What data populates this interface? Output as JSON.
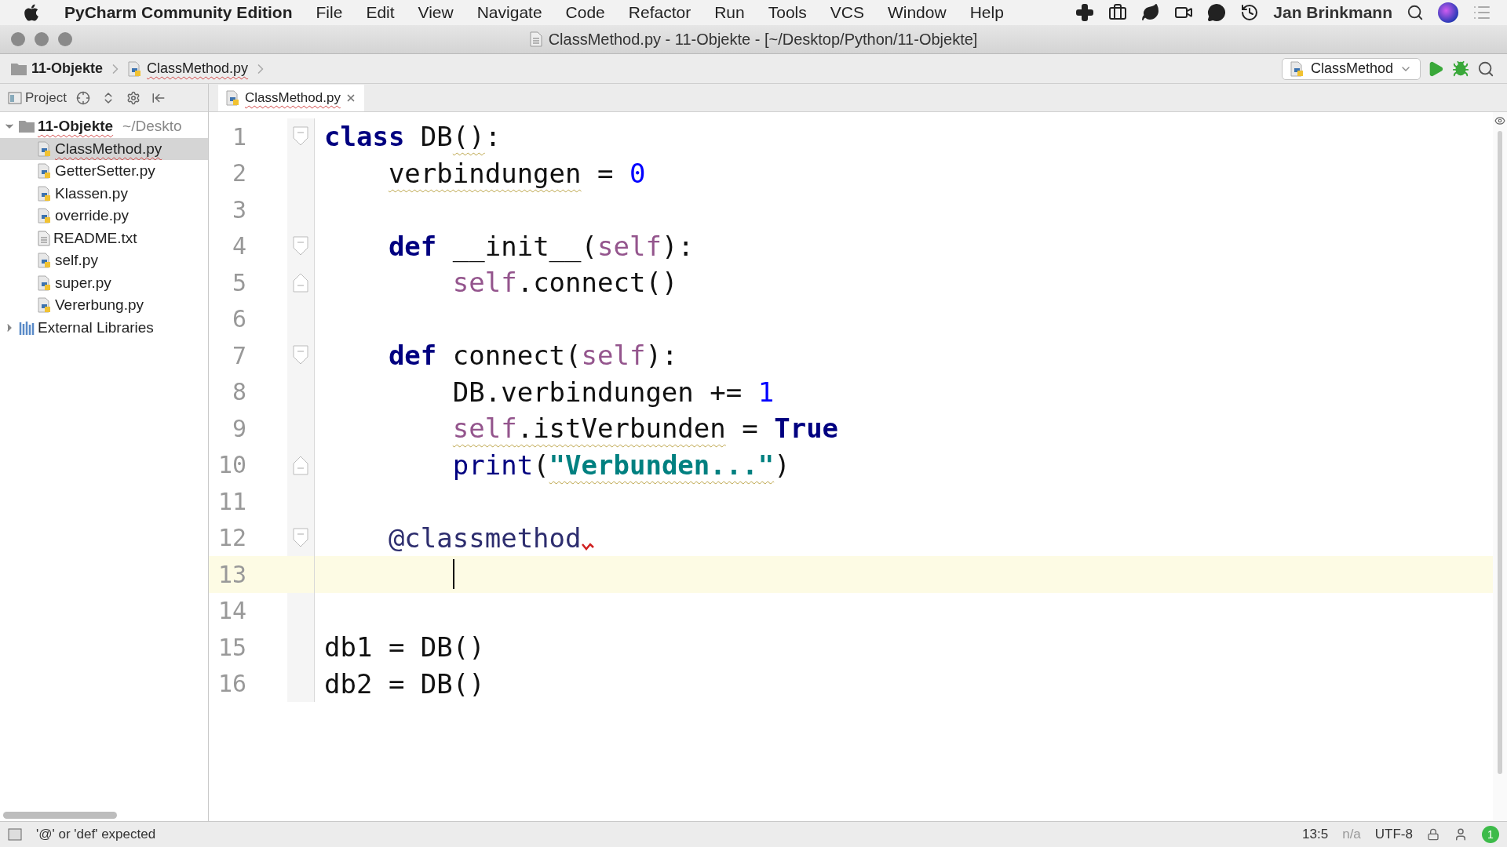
{
  "menu_bar": {
    "app_name": "PyCharm Community Edition",
    "menus": [
      "File",
      "Edit",
      "View",
      "Navigate",
      "Code",
      "Refactor",
      "Run",
      "Tools",
      "VCS",
      "Window",
      "Help"
    ],
    "user": "Jan Brinkmann"
  },
  "window": {
    "title": "ClassMethod.py - 11-Objekte - [~/Desktop/Python/11-Objekte]"
  },
  "breadcrumbs": [
    {
      "label": "11-Objekte",
      "kind": "folder",
      "squiggle": false
    },
    {
      "label": "ClassMethod.py",
      "kind": "python",
      "squiggle": true
    }
  ],
  "run_config": {
    "label": "ClassMethod"
  },
  "project_panel": {
    "label": "Project"
  },
  "tree": [
    {
      "label": "11-Objekte",
      "path": "~/Deskto",
      "kind": "folder",
      "expanded": true,
      "selected": false,
      "squiggle": true,
      "children": [
        {
          "label": "ClassMethod.py",
          "kind": "python",
          "selected": true,
          "squiggle": true
        },
        {
          "label": "GetterSetter.py",
          "kind": "python",
          "selected": false,
          "squiggle": false
        },
        {
          "label": "Klassen.py",
          "kind": "python",
          "selected": false,
          "squiggle": false
        },
        {
          "label": "override.py",
          "kind": "python",
          "selected": false,
          "squiggle": false
        },
        {
          "label": "README.txt",
          "kind": "text",
          "selected": false,
          "squiggle": false
        },
        {
          "label": "self.py",
          "kind": "python",
          "selected": false,
          "squiggle": false
        },
        {
          "label": "super.py",
          "kind": "python",
          "selected": false,
          "squiggle": false
        },
        {
          "label": "Vererbung.py",
          "kind": "python",
          "selected": false,
          "squiggle": false
        }
      ]
    },
    {
      "label": "External Libraries",
      "kind": "library",
      "expanded": false,
      "selected": false,
      "squiggle": false
    }
  ],
  "tabs": [
    {
      "label": "ClassMethod.py",
      "selected": true,
      "squiggle": true
    }
  ],
  "code_lines": [
    {
      "number": "1",
      "fold_start": true,
      "fold_end": false,
      "current": false,
      "tokens": [
        {
          "text": "class",
          "kind": "keyword",
          "squiggle": false
        },
        {
          "text": " DB",
          "kind": "plain",
          "squiggle": false
        },
        {
          "text": "()",
          "kind": "plain",
          "squiggle": true
        },
        {
          "text": ":",
          "kind": "plain",
          "squiggle": false
        }
      ]
    },
    {
      "number": "2",
      "fold_start": false,
      "fold_end": false,
      "current": false,
      "tokens": [
        {
          "text": "    verbindungen",
          "kind": "plain",
          "squiggle": true
        },
        {
          "text": " = ",
          "kind": "plain",
          "squiggle": false
        },
        {
          "text": "0",
          "kind": "number",
          "squiggle": false
        }
      ]
    },
    {
      "number": "3",
      "fold_start": false,
      "fold_end": false,
      "current": false
    },
    {
      "number": "4",
      "fold_start": true,
      "fold_end": false,
      "current": false,
      "tokens": [
        {
          "text": "    def",
          "kind": "keyword",
          "squiggle": false
        },
        {
          "text": " __init__(",
          "kind": "plain",
          "squiggle": false
        },
        {
          "text": "self",
          "kind": "self",
          "squiggle": false
        },
        {
          "text": "):",
          "kind": "plain",
          "squiggle": false
        }
      ]
    },
    {
      "number": "5",
      "fold_start": false,
      "fold_end": true,
      "current": false,
      "tokens": [
        {
          "text": "        self",
          "kind": "self",
          "squiggle": false
        },
        {
          "text": ".connect()",
          "kind": "plain",
          "squiggle": false
        }
      ]
    },
    {
      "number": "6",
      "fold_start": false,
      "fold_end": false,
      "current": false
    },
    {
      "number": "7",
      "fold_start": true,
      "fold_end": false,
      "current": false,
      "tokens": [
        {
          "text": "    def",
          "kind": "keyword",
          "squiggle": false
        },
        {
          "text": " connect(",
          "kind": "plain",
          "squiggle": false
        },
        {
          "text": "self",
          "kind": "self",
          "squiggle": false
        },
        {
          "text": "):",
          "kind": "plain",
          "squiggle": false
        }
      ]
    },
    {
      "number": "8",
      "fold_start": false,
      "fold_end": false,
      "current": false,
      "tokens": [
        {
          "text": "        DB.verbindungen += ",
          "kind": "plain",
          "squiggle": false
        },
        {
          "text": "1",
          "kind": "number",
          "squiggle": false
        }
      ]
    },
    {
      "number": "9",
      "fold_start": false,
      "fold_end": false,
      "current": false,
      "tokens": [
        {
          "text": "        self",
          "kind": "self",
          "squiggle": true
        },
        {
          "text": ".istVerbunden",
          "kind": "plain",
          "squiggle": true
        },
        {
          "text": " = ",
          "kind": "plain",
          "squiggle": false
        },
        {
          "text": "True",
          "kind": "keyword",
          "squiggle": false
        }
      ]
    },
    {
      "number": "10",
      "fold_start": false,
      "fold_end": true,
      "current": false,
      "tokens": [
        {
          "text": "        print",
          "kind": "builtin",
          "squiggle": false
        },
        {
          "text": "(",
          "kind": "plain",
          "squiggle": false
        },
        {
          "text": "\"Verbunden...\"",
          "kind": "string",
          "squiggle": true
        },
        {
          "text": ")",
          "kind": "plain",
          "squiggle": false
        }
      ]
    },
    {
      "number": "11",
      "fold_start": false,
      "fold_end": false,
      "current": false
    },
    {
      "number": "12",
      "fold_start": true,
      "fold_end": false,
      "current": false,
      "tokens": [
        {
          "text": "    @classmethod",
          "kind": "decorator",
          "squiggle": false
        },
        {
          "kind": "error_mark"
        }
      ]
    },
    {
      "number": "13",
      "fold_start": false,
      "fold_end": false,
      "current": true
    },
    {
      "number": "14",
      "fold_start": false,
      "fold_end": false,
      "current": false
    },
    {
      "number": "15",
      "fold_start": false,
      "fold_end": false,
      "current": false,
      "tokens": [
        {
          "text": "db1 = DB()",
          "kind": "plain",
          "squiggle": false
        }
      ]
    },
    {
      "number": "16",
      "fold_start": false,
      "fold_end": false,
      "current": false,
      "tokens": [
        {
          "text": "db2 = DB()",
          "kind": "plain",
          "squiggle": false
        }
      ]
    }
  ],
  "status_bar": {
    "message": "'@' or 'def' expected",
    "position": "13:5",
    "line_separator": "n/a",
    "encoding": "UTF-8",
    "notifications": "1"
  }
}
